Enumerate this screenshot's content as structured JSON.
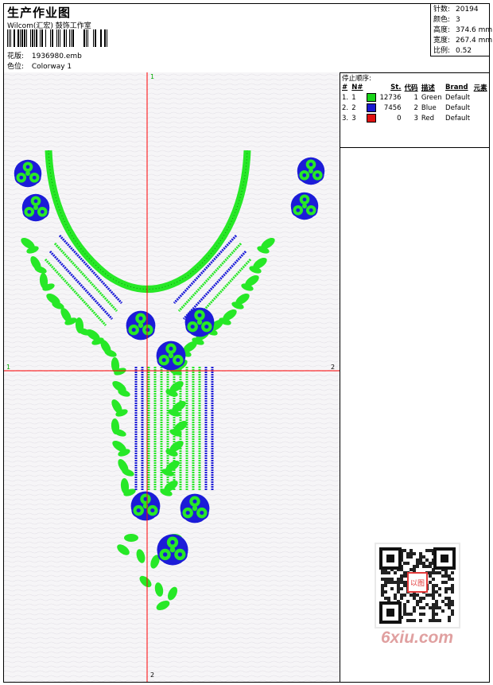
{
  "header": {
    "title": "生产作业图",
    "studio": "Wilcom(汇宏) 鼓饰工作室",
    "file_label": "花版:",
    "file_value": "1936980.emb",
    "colorway_label": "色位:",
    "colorway_value": "Colorway 1"
  },
  "stats": [
    {
      "label": "针数:",
      "value": "20194"
    },
    {
      "label": "颜色:",
      "value": "3"
    },
    {
      "label": "高度:",
      "value": "374.6 mm"
    },
    {
      "label": "宽度:",
      "value": "267.4 mm"
    },
    {
      "label": "比例:",
      "value": "0.52"
    }
  ],
  "stop_sequence": {
    "title": "停止顺序:",
    "headers": [
      "#",
      "N#",
      "St.",
      "代码",
      "描述",
      "Brand",
      "元素"
    ],
    "rows": [
      {
        "idx": "1.",
        "n": "1",
        "color": "#18d418",
        "st": "12736",
        "code": "1",
        "desc": "Green",
        "brand": "Default"
      },
      {
        "idx": "2.",
        "n": "2",
        "color": "#1a1ad0",
        "st": "7456",
        "code": "2",
        "desc": "Blue",
        "brand": "Default"
      },
      {
        "idx": "3.",
        "n": "3",
        "color": "#e01010",
        "st": "0",
        "code": "3",
        "desc": "Red",
        "brand": "Default"
      }
    ]
  },
  "axis_labels": {
    "top": "1",
    "bottom": "2",
    "left": "1",
    "right": "2"
  },
  "colors": {
    "green": "#27e827",
    "blue": "#1c1cd8",
    "crosshair": "#ff0000"
  },
  "watermark": {
    "text": "6xiu.com",
    "seal": "以图"
  }
}
